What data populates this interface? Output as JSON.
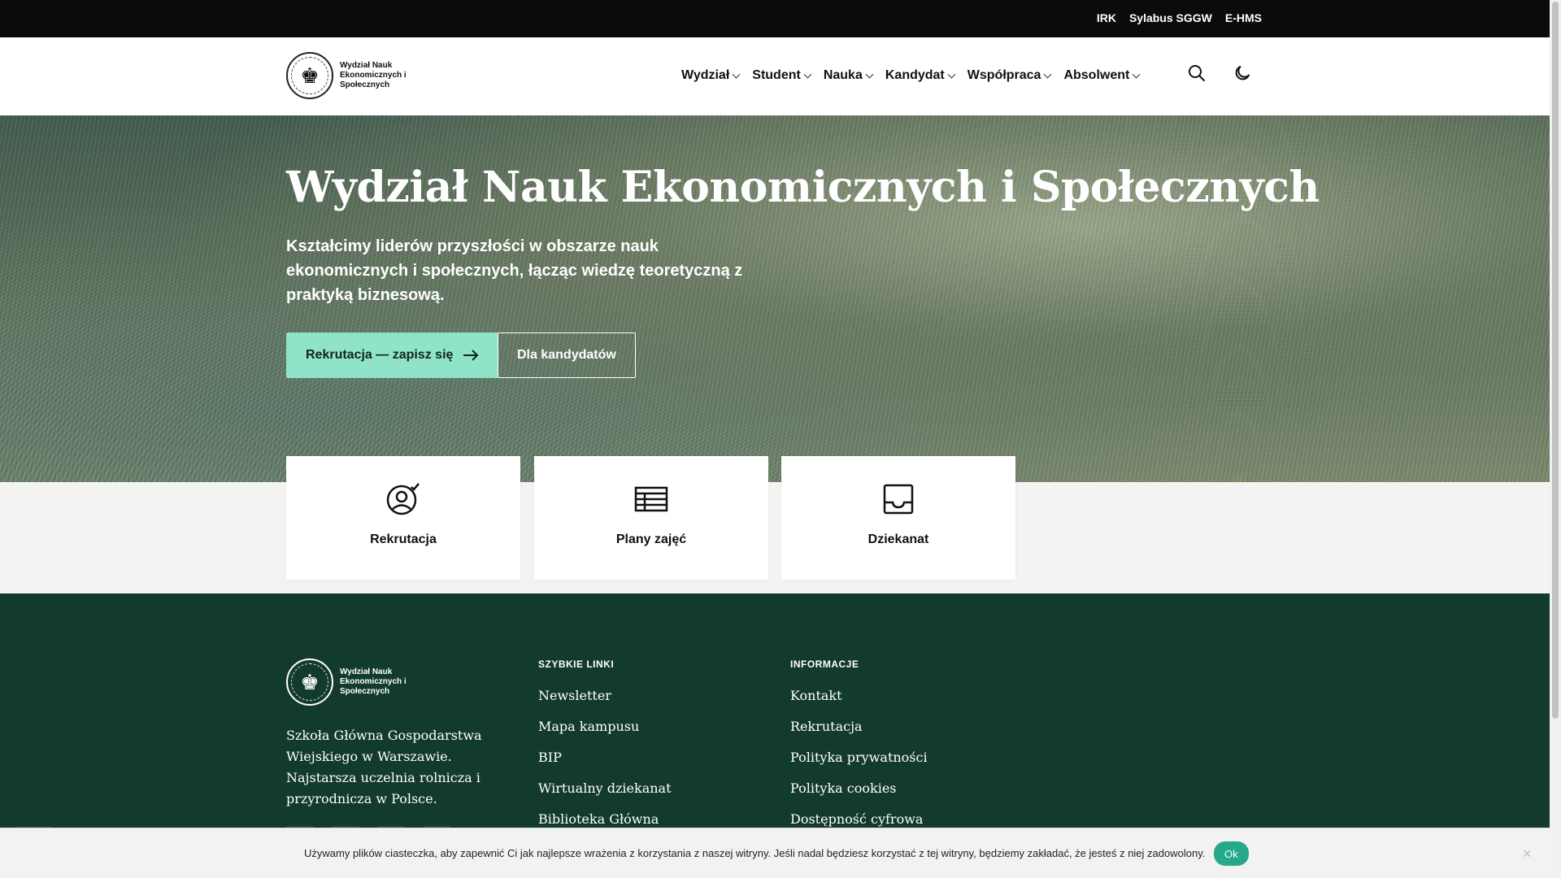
{
  "topbar": {
    "links": [
      "IRK",
      "Sylabus SGGW",
      "E-HMS"
    ]
  },
  "header": {
    "logo_text": "Wydział Nauk Ekonomicznych i Społecznych",
    "nav": [
      "Wydział",
      "Student",
      "Nauka",
      "Kandydat",
      "Współpraca",
      "Absolwent"
    ],
    "icons": [
      "search-icon",
      "moon-icon"
    ]
  },
  "hero": {
    "title": "Wydział Nauk Ekonomicznych i Społecznych",
    "subtitle": "Kształcimy liderów przyszłości w obszarze nauk ekonomicznych i społecznych, łącząc wiedzę teoretyczną z praktyką biznesową.",
    "primary_button": "Rekrutacja — zapisz się",
    "secondary_button": "Dla kandydatów"
  },
  "quick_cards": [
    {
      "label": "Rekrutacja",
      "icon": "user-check-icon"
    },
    {
      "label": "Plany zajęć",
      "icon": "table-icon"
    },
    {
      "label": "Dziekanat",
      "icon": "inbox-icon"
    }
  ],
  "footer": {
    "logo_text": "Wydział Nauk Ekonomicznych i Społecznych",
    "description": "Szkoła Główna Gospodarstwa Wiejskiego w Warszawie. Najstarsza uczelnia rolnicza i przyrodnicza w Polsce.",
    "quick_links_title": "SZYBKIE LINKI",
    "quick_links": [
      "Newsletter",
      "Mapa kampusu",
      "BIP",
      "Wirtualny dziekanat",
      "Biblioteka Główna"
    ],
    "info_title": "INFORMACJE",
    "info_links": [
      "Kontakt",
      "Rekrutacja",
      "Polityka prywatności",
      "Polityka cookies",
      "Dostępność cyfrowa"
    ]
  },
  "cookie": {
    "text": "Używamy plików ciasteczka, aby zapewnić Ci jak najlepsze wrażenia z korzystania z naszej witryny. Jeśli nadal będziesz korzystać z tej witryny, będziemy zakładać, że jesteś z niej zadowolony.",
    "ok_label": "Ok",
    "close": "×"
  },
  "colors": {
    "accent": "#8fe3c8",
    "footer_bg": "#123a2e",
    "topbar_bg": "#0b0b0b",
    "cookie_ok": "#25a98a"
  }
}
